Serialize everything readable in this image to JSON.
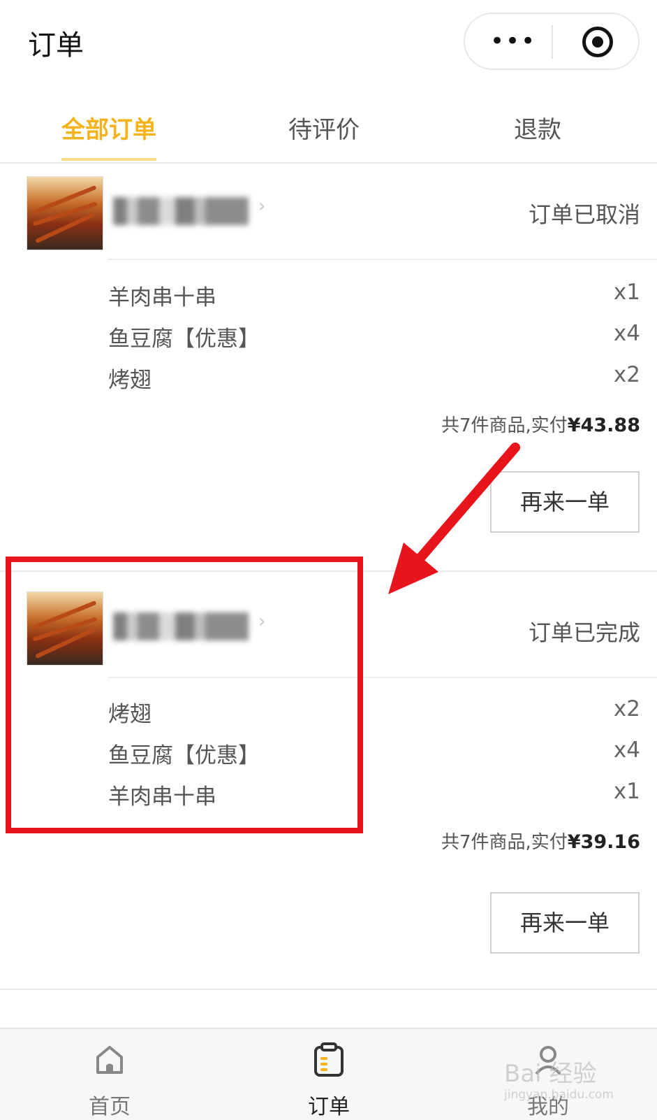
{
  "header": {
    "title": "订单",
    "more_glyph": "•••",
    "icons": [
      "more-icon",
      "target-icon"
    ]
  },
  "tabs": [
    {
      "label": "全部订单",
      "active": true
    },
    {
      "label": "待评价",
      "active": false
    },
    {
      "label": "退款",
      "active": false
    }
  ],
  "colors": {
    "accent": "#f5b31b",
    "highlight": "#e8141c"
  },
  "orders": [
    {
      "status": "订单已取消",
      "items": [
        {
          "name": "羊肉串十串",
          "qty": "x1"
        },
        {
          "name": "鱼豆腐【优惠】",
          "qty": "x4"
        },
        {
          "name": "烤翅",
          "qty": "x2"
        }
      ],
      "summary_prefix": "共7件商品,实付",
      "price": "¥43.88",
      "button": "再来一单"
    },
    {
      "status": "订单已完成",
      "items": [
        {
          "name": "烤翅",
          "qty": "x2"
        },
        {
          "name": "鱼豆腐【优惠】",
          "qty": "x4"
        },
        {
          "name": "羊肉串十串",
          "qty": "x1"
        }
      ],
      "summary_prefix": "共7件商品,实付",
      "price": "¥39.16",
      "button": "再来一单"
    }
  ],
  "tabbar": [
    {
      "label": "首页",
      "icon": "home-icon",
      "active": false
    },
    {
      "label": "订单",
      "icon": "order-icon",
      "active": true
    },
    {
      "label": "我的",
      "icon": "profile-icon",
      "active": false
    }
  ],
  "watermark": {
    "text": "Bai 经验",
    "sub": "jingyan.baidu.com"
  }
}
